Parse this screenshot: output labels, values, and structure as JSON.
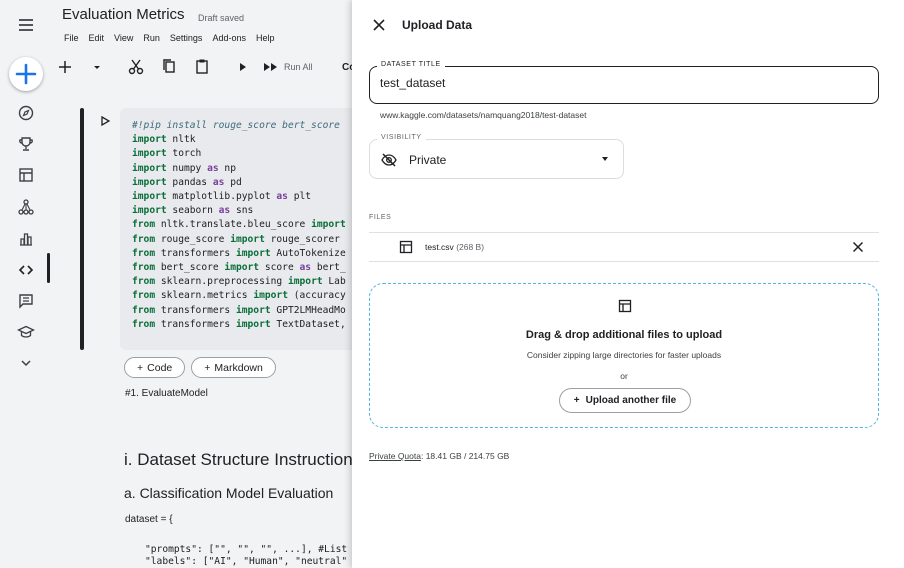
{
  "notebook": {
    "title": "Evaluation Metrics",
    "save_status": "Draft saved",
    "menu": [
      "File",
      "Edit",
      "View",
      "Run",
      "Settings",
      "Add-ons",
      "Help"
    ],
    "toolbar": {
      "run_all": "Run All",
      "truncated": "Co"
    },
    "code_lines": [
      [
        [
          "cm",
          "#!pip install rouge_score bert_score"
        ]
      ],
      [
        [
          "kw",
          "import"
        ],
        [
          "t",
          " nltk"
        ]
      ],
      [
        [
          "kw",
          "import"
        ],
        [
          "t",
          " torch"
        ]
      ],
      [
        [
          "kw",
          "import"
        ],
        [
          "t",
          " numpy "
        ],
        [
          "op",
          "as"
        ],
        [
          "t",
          " np"
        ]
      ],
      [
        [
          "kw",
          "import"
        ],
        [
          "t",
          " pandas "
        ],
        [
          "op",
          "as"
        ],
        [
          "t",
          " pd"
        ]
      ],
      [
        [
          "kw",
          "import"
        ],
        [
          "t",
          " matplotlib.pyplot "
        ],
        [
          "op",
          "as"
        ],
        [
          "t",
          " plt"
        ]
      ],
      [
        [
          "kw",
          "import"
        ],
        [
          "t",
          " seaborn "
        ],
        [
          "op",
          "as"
        ],
        [
          "t",
          " sns"
        ]
      ],
      [
        [
          "kw",
          "from"
        ],
        [
          "t",
          " nltk.translate.bleu_score "
        ],
        [
          "kw",
          "import"
        ]
      ],
      [
        [
          "kw",
          "from"
        ],
        [
          "t",
          " rouge_score "
        ],
        [
          "kw",
          "import"
        ],
        [
          "t",
          " rouge_scorer"
        ]
      ],
      [
        [
          "kw",
          "from"
        ],
        [
          "t",
          " transformers "
        ],
        [
          "kw",
          "import"
        ],
        [
          "t",
          " AutoTokenize"
        ]
      ],
      [
        [
          "kw",
          "from"
        ],
        [
          "t",
          " bert_score "
        ],
        [
          "kw",
          "import"
        ],
        [
          "t",
          " score "
        ],
        [
          "op",
          "as"
        ],
        [
          "t",
          " bert_"
        ]
      ],
      [
        [
          "kw",
          "from"
        ],
        [
          "t",
          " sklearn.preprocessing "
        ],
        [
          "kw",
          "import"
        ],
        [
          "t",
          " Lab"
        ]
      ],
      [
        [
          "kw",
          "from"
        ],
        [
          "t",
          " sklearn.metrics "
        ],
        [
          "kw",
          "import"
        ],
        [
          "t",
          " (accuracy"
        ]
      ],
      [
        [
          "kw",
          "from"
        ],
        [
          "t",
          " transformers "
        ],
        [
          "kw",
          "import"
        ],
        [
          "t",
          " GPT2LMHeadMo"
        ]
      ],
      [
        [
          "kw",
          "from"
        ],
        [
          "t",
          " transformers "
        ],
        [
          "kw",
          "import"
        ],
        [
          "t",
          " TextDataset,"
        ]
      ]
    ],
    "add_code": "Code",
    "add_markdown": "Markdown",
    "markdown_text": "#1. EvaluateModel",
    "heading1": "i. Dataset Structure Instruction",
    "heading2": "a. Classification Model Evaluation",
    "dataset_line": "dataset = {",
    "prompts_line": "\"prompts\": [\"\", \"\", \"\", ...], #List",
    "labels_line": "\"labels\": [\"AI\", \"Human\", \"neutral\""
  },
  "panel": {
    "title": "Upload Data",
    "dataset_title_label": "DATASET TITLE",
    "dataset_title_value": "test_dataset",
    "url": "www.kaggle.com/datasets/namquang2018/test-dataset",
    "visibility_label": "VISIBILITY",
    "visibility_value": "Private",
    "files_label": "FILES",
    "file": {
      "name": "test.csv",
      "size": "(268 B)"
    },
    "drop_heading": "Drag & drop additional files to upload",
    "drop_sub": "Consider zipping large directories for faster uploads",
    "drop_or": "or",
    "upload_another": "Upload another file",
    "quota_label": "Private Quota",
    "quota_value": ": 18.41 GB / 214.75 GB"
  },
  "colors": {
    "accent": "#1a73e8",
    "drop_border": "#4fb4e6"
  }
}
